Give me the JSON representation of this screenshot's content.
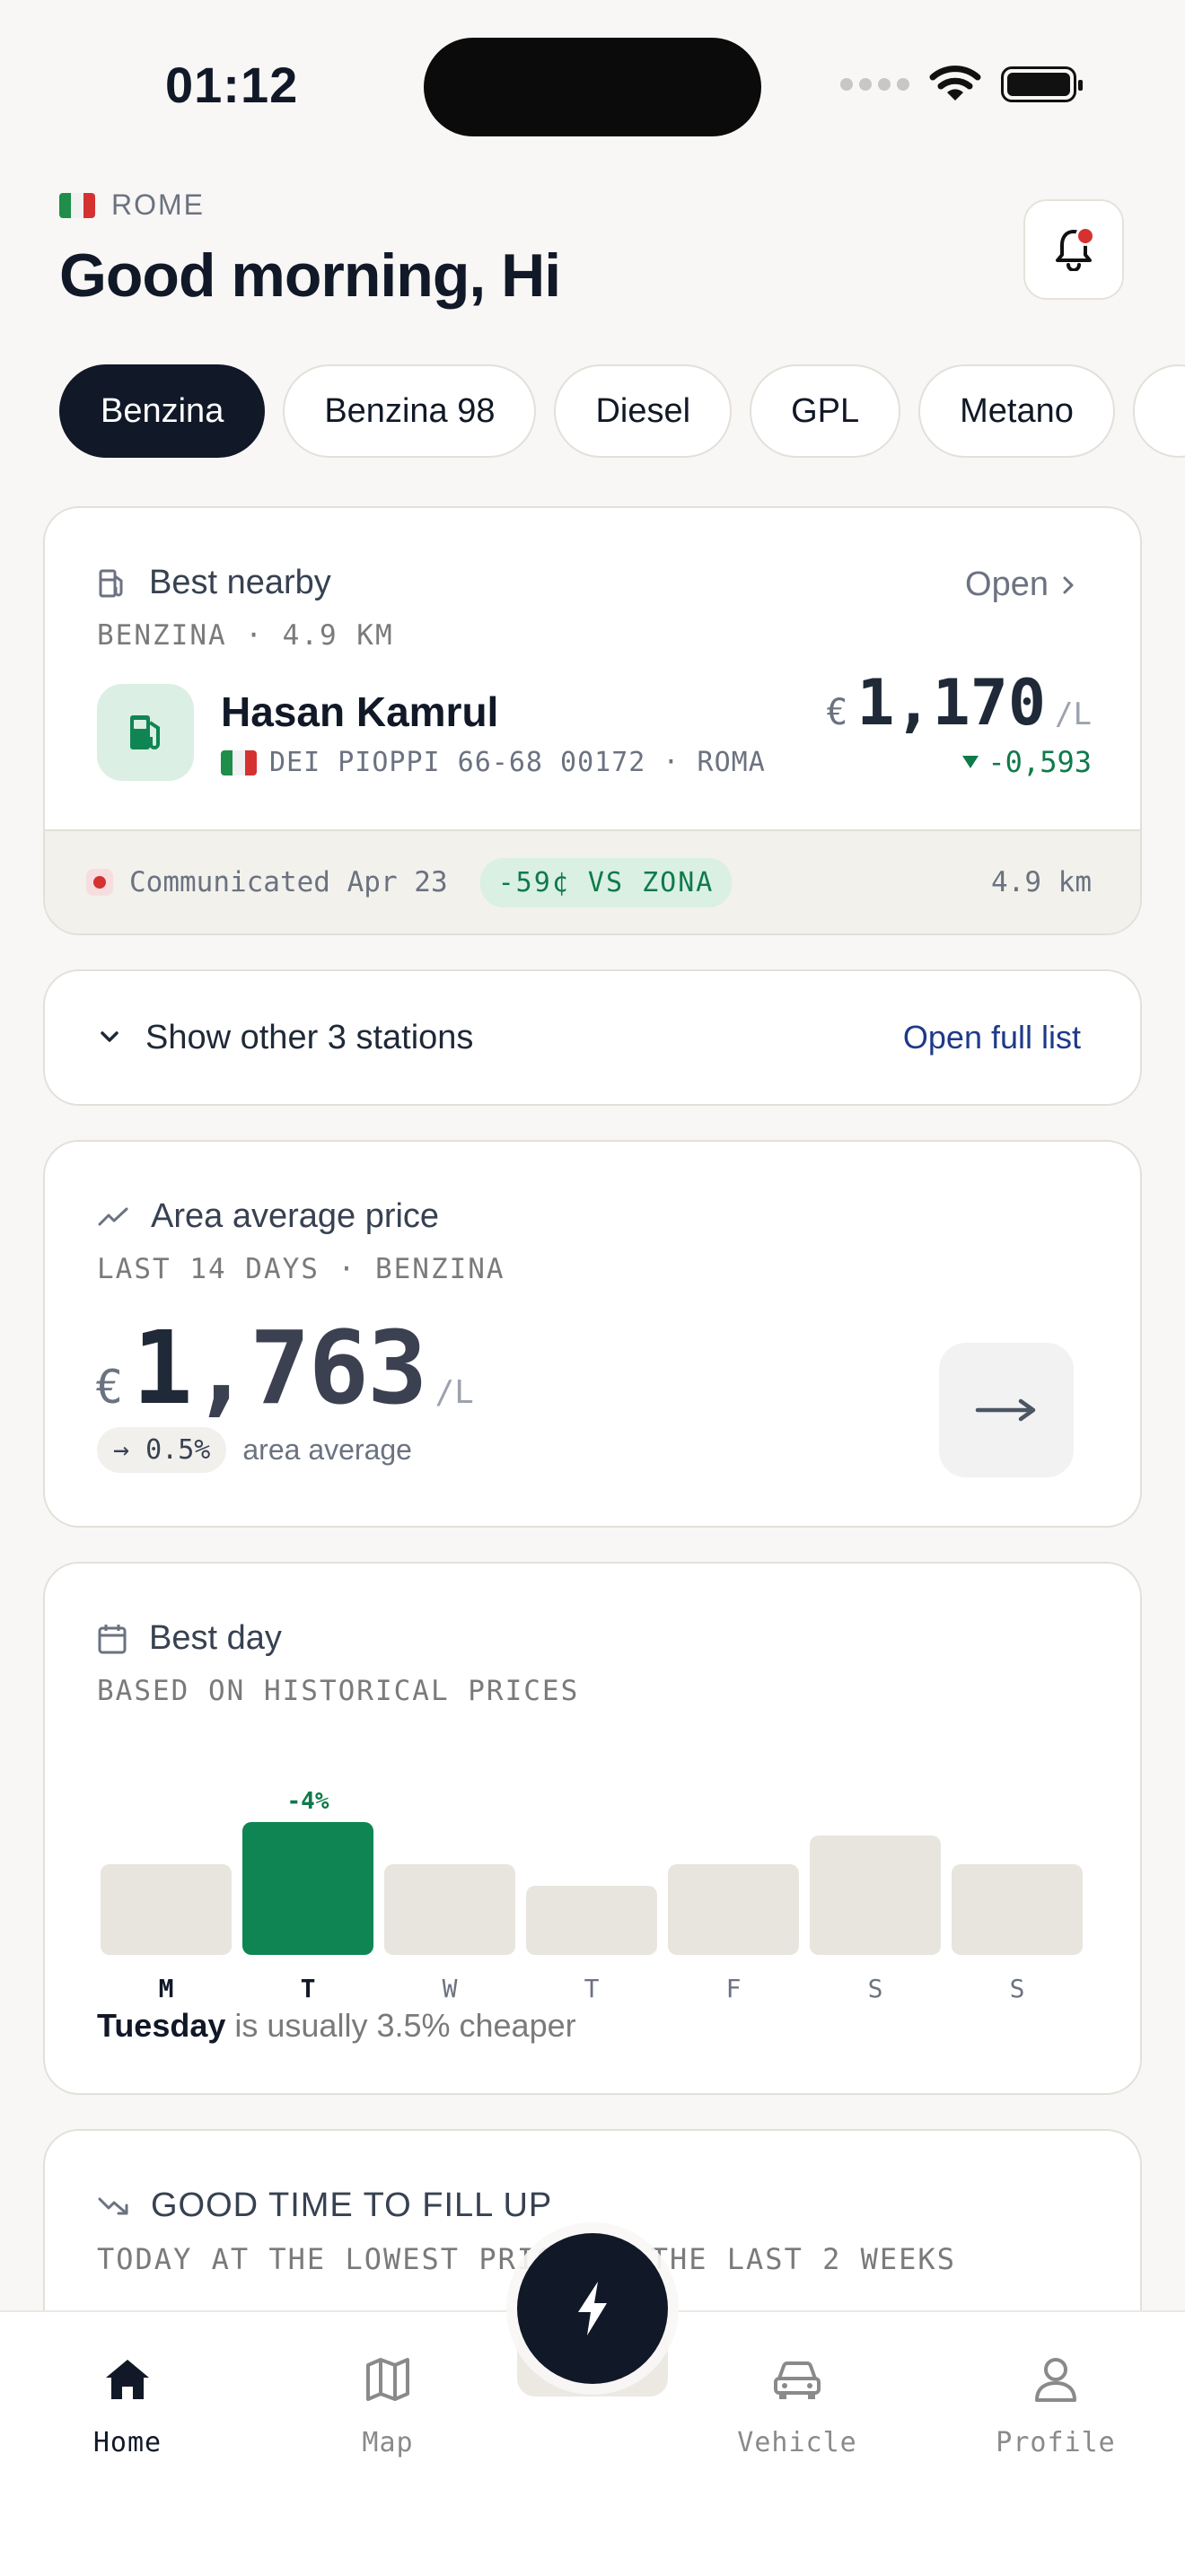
{
  "status_bar": {
    "time": "01:12"
  },
  "header": {
    "city": "ROME",
    "greeting": "Good morning, Hi"
  },
  "fuel_types": [
    {
      "label": "Benzina",
      "active": true
    },
    {
      "label": "Benzina 98",
      "active": false
    },
    {
      "label": "Diesel",
      "active": false
    },
    {
      "label": "GPL",
      "active": false
    },
    {
      "label": "Metano",
      "active": false
    }
  ],
  "best_nearby": {
    "title": "Best nearby",
    "open_label": "Open",
    "subtitle": "BENZINA · 4.9 KM",
    "station_name": "Hasan Kamrul",
    "address": "DEI PIOPPI 66-68 00172 · ROMA",
    "currency": "€",
    "price": "1,170",
    "unit": "/L",
    "delta": "-0,593",
    "communicated": "Communicated Apr 23",
    "zone_badge": "-59¢ VS ZONA",
    "distance": "4.9 km"
  },
  "other_stations": {
    "label": "Show other 3 stations",
    "link": "Open full list"
  },
  "area_average": {
    "title": "Area average price",
    "subtitle": "LAST 14 DAYS · BENZINA",
    "currency": "€",
    "price_int": "1",
    "price_dec": ",763",
    "unit": "/L",
    "trend": "→ 0.5%",
    "trend_label": "area average"
  },
  "best_day": {
    "title": "Best day",
    "subtitle": "BASED ON HISTORICAL PRICES",
    "days": [
      {
        "label": "M",
        "level": 0.56,
        "highlight": false,
        "bold": true
      },
      {
        "label": "T",
        "level": 0.82,
        "highlight": true,
        "bold": true,
        "pct": "-4%"
      },
      {
        "label": "W",
        "level": 0.56,
        "highlight": false,
        "bold": false
      },
      {
        "label": "T",
        "level": 0.43,
        "highlight": false,
        "bold": false
      },
      {
        "label": "F",
        "level": 0.56,
        "highlight": false,
        "bold": false
      },
      {
        "label": "S",
        "level": 0.74,
        "highlight": false,
        "bold": false
      },
      {
        "label": "S",
        "level": 0.56,
        "highlight": false,
        "bold": false
      }
    ],
    "note_day": "Tuesday",
    "note_rest": " is usually 3.5% cheaper"
  },
  "good_time": {
    "title": "GOOD TIME TO FILL UP",
    "subtitle": "TODAY AT THE LOWEST PRICE OF THE LAST 2 WEEKS"
  },
  "tabbar": {
    "home": "Home",
    "map": "Map",
    "vehicle": "Vehicle",
    "profile": "Profile"
  },
  "colors": {
    "accent_green": "#0f8554",
    "dark": "#111827",
    "alert_red": "#d63131",
    "link_blue": "#1e3a8a"
  }
}
